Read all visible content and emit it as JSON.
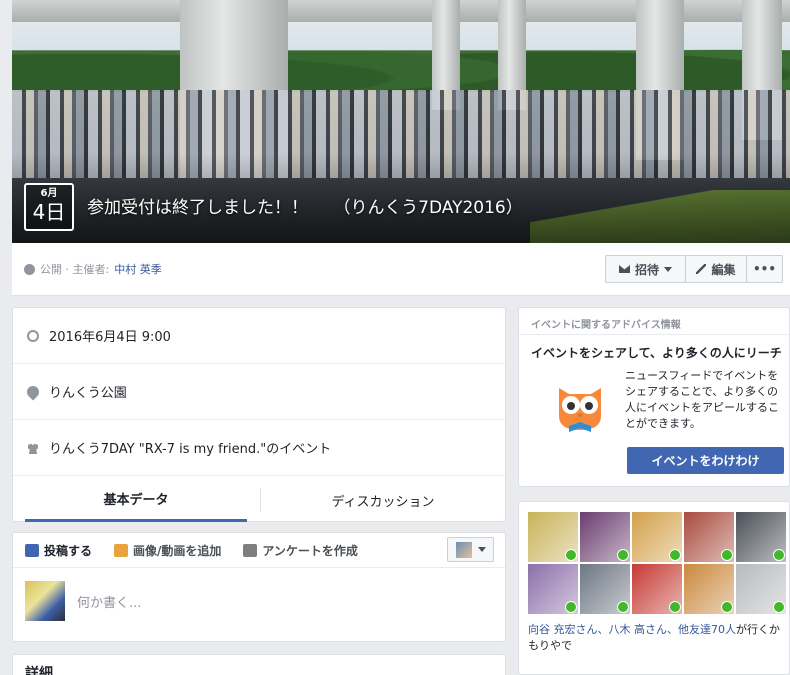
{
  "event": {
    "month": "6月",
    "day": "4日",
    "title": "参加受付は終了しました！！　　（りんくう7DAY2016）",
    "privacy": "公開 · 主催者: ",
    "host": "中村 英季"
  },
  "actions": {
    "invite_label": "招待",
    "edit_label": "編集",
    "more_label": "•••"
  },
  "info": {
    "datetime": "2016年6月4日 9:00",
    "location": "りんくう公園",
    "group": "りんくう7DAY \"RX-7 is my friend.\"のイベント"
  },
  "tabs": [
    {
      "label": "基本データ"
    },
    {
      "label": "ディスカッション"
    }
  ],
  "composer": {
    "post_label": "投稿する",
    "photo_label": "画像/動画を追加",
    "poll_label": "アンケートを作成",
    "placeholder": "何か書く..."
  },
  "details": {
    "heading": "詳細"
  },
  "advice": {
    "heading": "イベントに関するアドバイス情報",
    "title": "イベントをシェアして、より多くの人にリーチ",
    "body": "ニュースフィードでイベントをシェアすることで、より多くの人にイベントをアピールすることができます。",
    "button": "イベントをわけわけ"
  },
  "friends": {
    "names": "向谷 充宏さん、八木 高さん、",
    "others": "他友達70人",
    "suffix": "が行くかもりやで",
    "thumb_colors": [
      "#c8b35a",
      "#6a3d6e",
      "#d3a04a",
      "#a94b3e",
      "#4a4f57",
      "#8c6fa8",
      "#6d7683",
      "#c53a33",
      "#c9893d",
      "#b7b9bc"
    ]
  },
  "colors": {
    "brand_blue": "#4267b2",
    "link": "#365899",
    "going_check": "#42b72a"
  }
}
